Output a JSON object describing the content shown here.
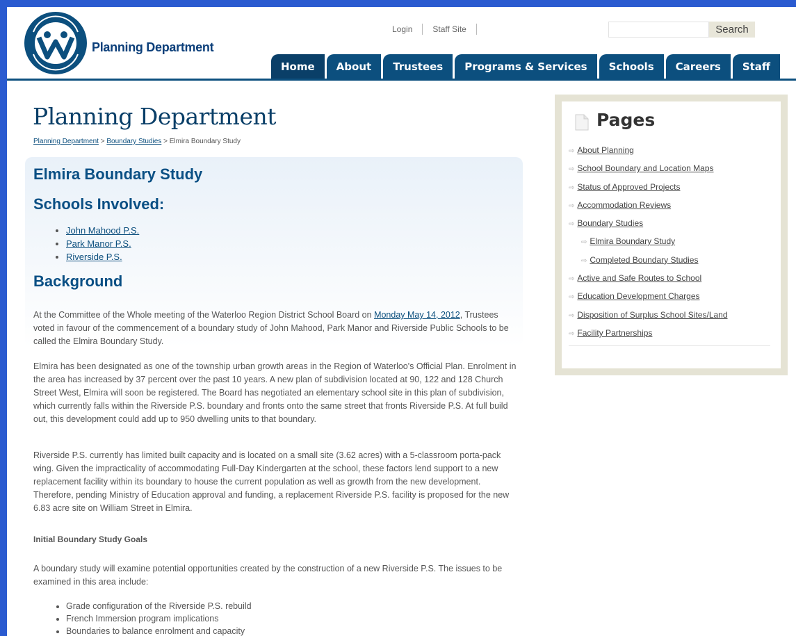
{
  "header": {
    "brand": "Planning Department",
    "login": "Login",
    "staff_site": "Staff Site",
    "search_button": "Search",
    "search_placeholder": ""
  },
  "nav": [
    "Home",
    "About",
    "Trustees",
    "Programs & Services",
    "Schools",
    "Careers",
    "Staff"
  ],
  "main": {
    "page_title": "Planning Department",
    "breadcrumb": {
      "crumb1": "Planning Department",
      "sep1": " > ",
      "crumb2": "Boundary Studies",
      "sep2": " > ",
      "current": "Elmira Boundary Study"
    },
    "study_title": "Elmira Boundary Study",
    "schools_heading": "Schools Involved:",
    "schools": [
      "John Mahood P.S.",
      "Park Manor P.S.",
      "Riverside P.S."
    ],
    "background_heading": "Background",
    "para1": {
      "before": "At the Committee of the Whole meeting of the Waterloo Region District School Board on ",
      "link": "Monday May 14, 2012",
      "after": ", Trustees voted in favour of the commencement of a boundary study of John Mahood, Park Manor and Riverside Public Schools to be called the Elmira Boundary Study."
    },
    "para2": "Elmira has been designated as one of the township urban growth areas in the Region of Waterloo's Official Plan. Enrolment in the area has increased by 37 percent over the past 10 years. A new plan of subdivision located at 90, 122 and 128 Church Street West, Elmira will soon be registered. The Board has negotiated an elementary school site in this plan of subdivision, which currently falls within the Riverside P.S. boundary and fronts onto the same street that fronts Riverside P.S. At full build out, this development could add up to 950 dwelling units to that boundary.",
    "para3": "Riverside P.S. currently has limited built capacity and is located on a small site (3.62 acres) with a 5-classroom porta-pack wing. Given the impracticality of accommodating Full-Day Kindergarten at the school, these factors lend support to a new replacement facility within its boundary to house the current population as well as growth from the new development. Therefore, pending Ministry of Education approval and funding, a replacement Riverside P.S. facility is proposed for the new 6.83 acre site on William Street in Elmira.",
    "goals_heading": "Initial Boundary Study Goals",
    "para4": "A boundary study will examine potential opportunities created by the construction of a new Riverside P.S.  The issues to be examined in this area include:",
    "issues": [
      "Grade configuration of the Riverside P.S. rebuild",
      "French Immersion program implications",
      "Boundaries to balance enrolment and capacity"
    ]
  },
  "sidebar": {
    "title": "Pages",
    "items": [
      {
        "label": "About Planning",
        "sub": false
      },
      {
        "label": "School Boundary and Location Maps",
        "sub": false
      },
      {
        "label": "Status of Approved Projects",
        "sub": false
      },
      {
        "label": "Accommodation Reviews",
        "sub": false
      },
      {
        "label": "Boundary Studies",
        "sub": false
      },
      {
        "label": "Elmira Boundary Study",
        "sub": true
      },
      {
        "label": "Completed Boundary Studies",
        "sub": true
      },
      {
        "label": "Active and Safe Routes to School",
        "sub": false
      },
      {
        "label": "Education Development Charges",
        "sub": false
      },
      {
        "label": "Disposition of Surplus School Sites/Land",
        "sub": false
      },
      {
        "label": "Facility Partnerships",
        "sub": false
      }
    ]
  },
  "colors": {
    "frame_bg": "#2a5bd0",
    "nav_tab": "#0c4f7e",
    "heading": "#0a4f84",
    "sidebar_border": "#e5e3d4"
  }
}
